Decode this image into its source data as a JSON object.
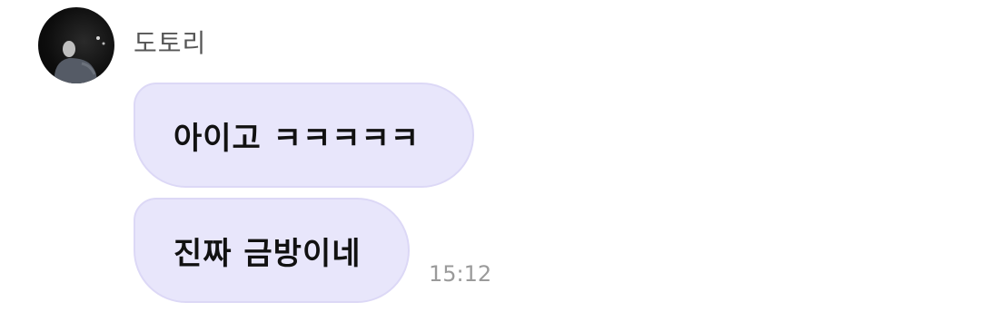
{
  "chat": {
    "sender": {
      "name": "도토리",
      "avatar_icon": "profile-photo"
    },
    "messages": [
      {
        "text": "아이고 ㅋㅋㅋㅋㅋ"
      },
      {
        "text": "진짜 금방이네"
      }
    ],
    "timestamp": "15:12"
  },
  "colors": {
    "bubble_background": "#e8e6fb",
    "bubble_border": "#dcd8f6",
    "name_text": "#555555",
    "timestamp_text": "#9a9a9a"
  }
}
